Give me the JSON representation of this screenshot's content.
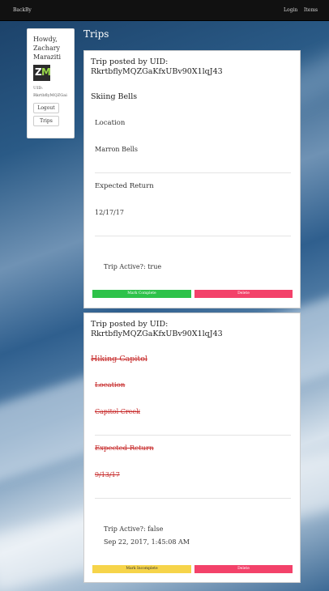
{
  "navbar": {
    "brand": "BackBy",
    "login": "Login",
    "items": "Items"
  },
  "sidebar": {
    "greeting": "Howdy, Zachary Maraziti",
    "avatar_text": {
      "first": "Z",
      "second": "M"
    },
    "uid_label": "UID:",
    "uid_value": "RkrtbflyMQZGai",
    "logout": "Logout",
    "trips": "Trips"
  },
  "page": {
    "title": "Trips"
  },
  "trips": [
    {
      "header": "Trip posted by UID: RkrtbflyMQZGaKfxUBv90X1lqJ43",
      "name": "Skiing Bells",
      "location_label": "Location",
      "location": "Marron Bells",
      "return_label": "Expected Return",
      "return": "12/17/17",
      "active": "Trip Active?: true",
      "timestamp": "",
      "primary_button": "Mark Complete",
      "delete_button": "Delete"
    },
    {
      "header": "Trip posted by UID: RkrtbflyMQZGaKfxUBv90X1lqJ43",
      "name": "Hiking Capitol",
      "location_label": "Location",
      "location": "Capitol Creek",
      "return_label": "Expected Return",
      "return": "9/13/17",
      "active": "Trip Active?: false",
      "timestamp": "Sep 22, 2017, 1:45:08 AM",
      "primary_button": "Mark Incomplete",
      "delete_button": "Delete"
    }
  ],
  "colors": {
    "complete": "#2ec24a",
    "incomplete": "#f6d44a",
    "delete": "#f3426a",
    "strike": "#c62828"
  }
}
